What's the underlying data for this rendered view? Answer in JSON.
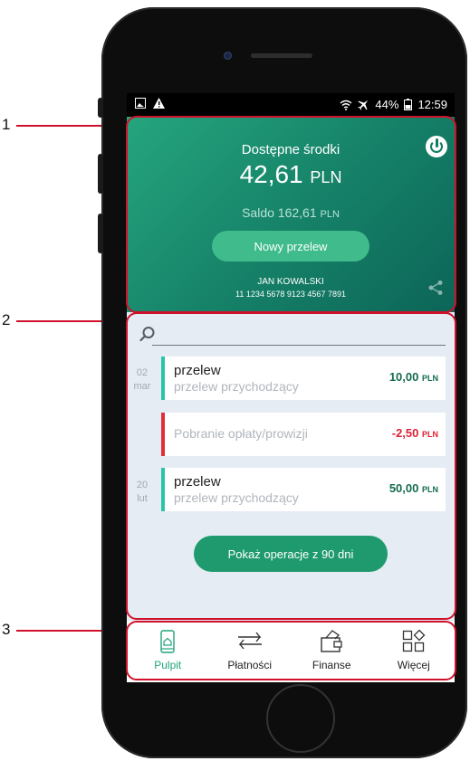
{
  "callouts": [
    "1",
    "2",
    "3"
  ],
  "status_bar": {
    "icons_left": [
      "image-icon",
      "warning-icon"
    ],
    "icons_right": [
      "wifi-icon",
      "airplane-icon",
      "battery-icon"
    ],
    "battery": "44%",
    "time": "12:59"
  },
  "card": {
    "available_label": "Dostępne środki",
    "available_amount": "42,61",
    "available_currency": "PLN",
    "saldo_label": "Saldo",
    "saldo_amount": "162,61",
    "saldo_currency": "PLN",
    "new_transfer_label": "Nowy przelew",
    "owner_name": "JAN KOWALSKI",
    "account_number": "11 1234 5678 9123 4567 7891"
  },
  "transactions": [
    {
      "day": "02",
      "month": "mar",
      "title": "przelew",
      "subtitle": "przelew przychodzący",
      "amount": "10,00",
      "currency": "PLN",
      "status_color": "#29c4a9"
    },
    {
      "day": "",
      "month": "",
      "title": "",
      "subtitle": "Pobranie opłaty/prowizji",
      "amount": "-2,50",
      "currency": "PLN",
      "status_color": "#e02e3b"
    },
    {
      "day": "20",
      "month": "lut",
      "title": "przelew",
      "subtitle": "przelew przychodzący",
      "amount": "50,00",
      "currency": "PLN",
      "status_color": "#29c4a9"
    }
  ],
  "show_more_label": "Pokaż operacje z 90 dni",
  "nav": [
    {
      "label": "Pulpit",
      "icon": "home-icon",
      "active": true
    },
    {
      "label": "Płatności",
      "icon": "transfer-arrows-icon",
      "active": false
    },
    {
      "label": "Finanse",
      "icon": "wallet-icon",
      "active": false
    },
    {
      "label": "Więcej",
      "icon": "more-shapes-icon",
      "active": false
    }
  ],
  "colors": {
    "accent": "#21a47d",
    "card_gradient_start": "#25a57e",
    "card_gradient_end": "#0c6558",
    "income": "#146b4e",
    "expense": "#df1f34",
    "highlight": "#d0112b"
  }
}
